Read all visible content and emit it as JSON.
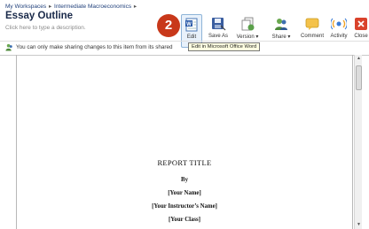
{
  "breadcrumb": {
    "items": [
      "My Workspaces",
      "Intermediate Macroeconomics"
    ],
    "sep": "▸"
  },
  "page": {
    "title": "Essay Outline",
    "description": "Click here to type a description."
  },
  "badge": {
    "number": "2"
  },
  "toolbar": {
    "buttons": [
      {
        "label": "Edit",
        "icon": "edit-word-icon"
      },
      {
        "label": "Save As",
        "icon": "save-as-icon"
      },
      {
        "label": "Version ▾",
        "icon": "version-icon"
      },
      {
        "label": "Share ▾",
        "icon": "share-icon"
      },
      {
        "label": "Comment",
        "icon": "comment-icon"
      },
      {
        "label": "Activity",
        "icon": "activity-icon"
      },
      {
        "label": "Close",
        "icon": "close-icon"
      }
    ]
  },
  "infobar": {
    "text": "You can only make sharing changes to this item from its shared"
  },
  "tooltip": {
    "text": "Edit in Microsoft Office Word"
  },
  "document": {
    "title": "REPORT TITLE",
    "by": "By",
    "name": "[Your Name]",
    "instructor": "[Your Instructor’s Name]",
    "class": "[Your Class]"
  },
  "colors": {
    "badge": "#c8381a",
    "title": "#1a2a4a",
    "link": "#1f3f7a"
  }
}
